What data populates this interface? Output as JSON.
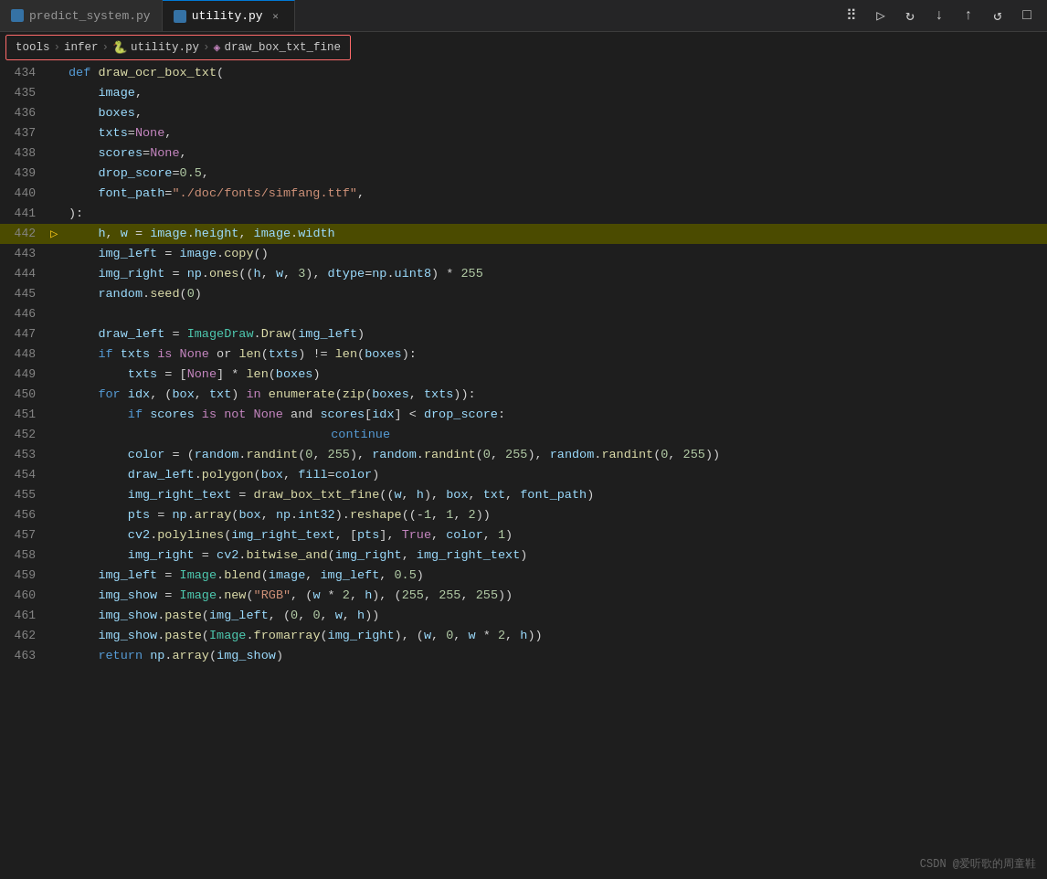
{
  "tabs": [
    {
      "label": "predict_system.py",
      "active": false,
      "modified": false
    },
    {
      "label": "utility.py",
      "active": true,
      "modified": false
    }
  ],
  "breadcrumb": {
    "items": [
      "tools",
      "infer",
      "utility.py",
      "draw_box_txt_fine"
    ]
  },
  "toolbar": {
    "icons": [
      "grid",
      "play",
      "step-over",
      "step-into",
      "step-out",
      "restart",
      "stop"
    ]
  },
  "code": {
    "lines": [
      {
        "num": 434,
        "content": "def draw_ocr_box_txt(",
        "highlight": false,
        "debug": false
      },
      {
        "num": 435,
        "content": "    image,",
        "highlight": false,
        "debug": false
      },
      {
        "num": 436,
        "content": "    boxes,",
        "highlight": false,
        "debug": false
      },
      {
        "num": 437,
        "content": "    txts=None,",
        "highlight": false,
        "debug": false
      },
      {
        "num": 438,
        "content": "    scores=None,",
        "highlight": false,
        "debug": false
      },
      {
        "num": 439,
        "content": "    drop_score=0.5,",
        "highlight": false,
        "debug": false
      },
      {
        "num": 440,
        "content": "    font_path=\"./doc/fonts/simfang.ttf\",",
        "highlight": false,
        "debug": false
      },
      {
        "num": 441,
        "content": "):",
        "highlight": false,
        "debug": false
      },
      {
        "num": 442,
        "content": "    h, w = image.height, image.width",
        "highlight": true,
        "debug": true
      },
      {
        "num": 443,
        "content": "    img_left = image.copy()",
        "highlight": false,
        "debug": false
      },
      {
        "num": 444,
        "content": "    img_right = np.ones((h, w, 3), dtype=np.uint8) * 255",
        "highlight": false,
        "debug": false
      },
      {
        "num": 445,
        "content": "    random.seed(0)",
        "highlight": false,
        "debug": false
      },
      {
        "num": 446,
        "content": "",
        "highlight": false,
        "debug": false
      },
      {
        "num": 447,
        "content": "    draw_left = ImageDraw.Draw(img_left)",
        "highlight": false,
        "debug": false
      },
      {
        "num": 448,
        "content": "    if txts is None or len(txts) != len(boxes):",
        "highlight": false,
        "debug": false
      },
      {
        "num": 449,
        "content": "        txts = [None] * len(boxes)",
        "highlight": false,
        "debug": false
      },
      {
        "num": 450,
        "content": "    for idx, (box, txt) in enumerate(zip(boxes, txts)):",
        "highlight": false,
        "debug": false
      },
      {
        "num": 451,
        "content": "        if scores is not None and scores[idx] < drop_score:",
        "highlight": false,
        "debug": false
      },
      {
        "num": 452,
        "content": "            continue",
        "highlight": false,
        "debug": false
      },
      {
        "num": 453,
        "content": "        color = (random.randint(0, 255), random.randint(0, 255), random.randint(0, 255))",
        "highlight": false,
        "debug": false
      },
      {
        "num": 454,
        "content": "        draw_left.polygon(box, fill=color)",
        "highlight": false,
        "debug": false
      },
      {
        "num": 455,
        "content": "        img_right_text = draw_box_txt_fine((w, h), box, txt, font_path)",
        "highlight": false,
        "debug": false
      },
      {
        "num": 456,
        "content": "        pts = np.array(box, np.int32).reshape((-1, 1, 2))",
        "highlight": false,
        "debug": false
      },
      {
        "num": 457,
        "content": "        cv2.polylines(img_right_text, [pts], True, color, 1)",
        "highlight": false,
        "debug": false
      },
      {
        "num": 458,
        "content": "        img_right = cv2.bitwise_and(img_right, img_right_text)",
        "highlight": false,
        "debug": false
      },
      {
        "num": 459,
        "content": "    img_left = Image.blend(image, img_left, 0.5)",
        "highlight": false,
        "debug": false
      },
      {
        "num": 460,
        "content": "    img_show = Image.new(\"RGB\", (w * 2, h), (255, 255, 255))",
        "highlight": false,
        "debug": false
      },
      {
        "num": 461,
        "content": "    img_show.paste(img_left, (0, 0, w, h))",
        "highlight": false,
        "debug": false
      },
      {
        "num": 462,
        "content": "    img_show.paste(Image.fromarray(img_right), (w, 0, w * 2, h))",
        "highlight": false,
        "debug": false
      },
      {
        "num": 463,
        "content": "    return np.array(img_show)",
        "highlight": false,
        "debug": false
      }
    ]
  },
  "watermark": "CSDN @爱听歌的周童鞋"
}
